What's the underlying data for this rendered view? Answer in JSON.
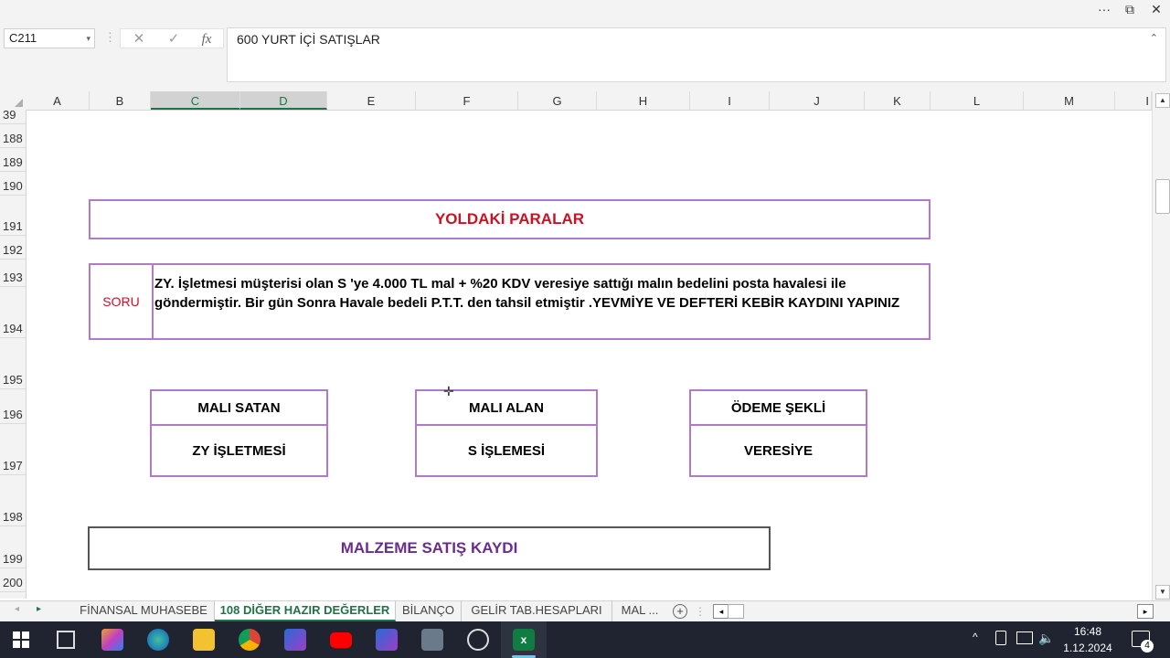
{
  "window": {
    "more_label": "···",
    "restore_label": "⧉",
    "close_label": "✕"
  },
  "formula_bar": {
    "name_box": "C211",
    "name_box_arrow": "▾",
    "cancel_label": "✕",
    "enter_label": "✓",
    "fx_label": "fx",
    "content": "600 YURT İÇİ SATIŞLAR",
    "collapse_label": "⌃",
    "separator": "⋮"
  },
  "columns": [
    "A",
    "B",
    "C",
    "D",
    "E",
    "F",
    "G",
    "H",
    "I",
    "J",
    "K",
    "L",
    "M",
    "I"
  ],
  "rows": [
    "39",
    "188",
    "189",
    "190",
    "191",
    "192",
    "193",
    "194",
    "195",
    "196",
    "197",
    "198",
    "199",
    "200"
  ],
  "sheet": {
    "title1": "YOLDAKİ PARALAR",
    "soru_label": "SORU",
    "question": "ZY. İşletmesi müşterisi olan S 'ye  4.000 TL mal + %20 KDV  veresiye sattığı malın bedelini posta havalesi ile göndermiştir. Bir gün Sonra Havale bedeli P.T.T. den tahsil etmiştir .YEVMİYE VE DEFTERİ KEBİR KAYDINI YAPINIZ",
    "boxes": [
      {
        "header": "MALI SATAN",
        "value": "ZY İŞLETMESİ"
      },
      {
        "header": "MALI ALAN",
        "value": "S İŞLEMESİ"
      },
      {
        "header": "ÖDEME ŞEKLİ",
        "value": "VERESİYE"
      }
    ],
    "title2": "MALZEME SATIŞ KAYDI"
  },
  "tabs": {
    "prev_label": "◂",
    "next_label": "▸",
    "items": [
      "FİNANSAL MUHASEBE",
      "108 DİĞER HAZIR DEĞERLER",
      "BİLANÇO",
      "GELİR TAB.HESAPLARI",
      "MAL ..."
    ],
    "add_label": "+",
    "hscroll_left": "◂",
    "hscroll_right": "▸"
  },
  "taskbar": {
    "time": "16:48",
    "date": "1.12.2024",
    "notif_count": "4",
    "tray_up": "^",
    "colors": {
      "active_app": "#107c41",
      "bg": "#1f2430"
    }
  }
}
